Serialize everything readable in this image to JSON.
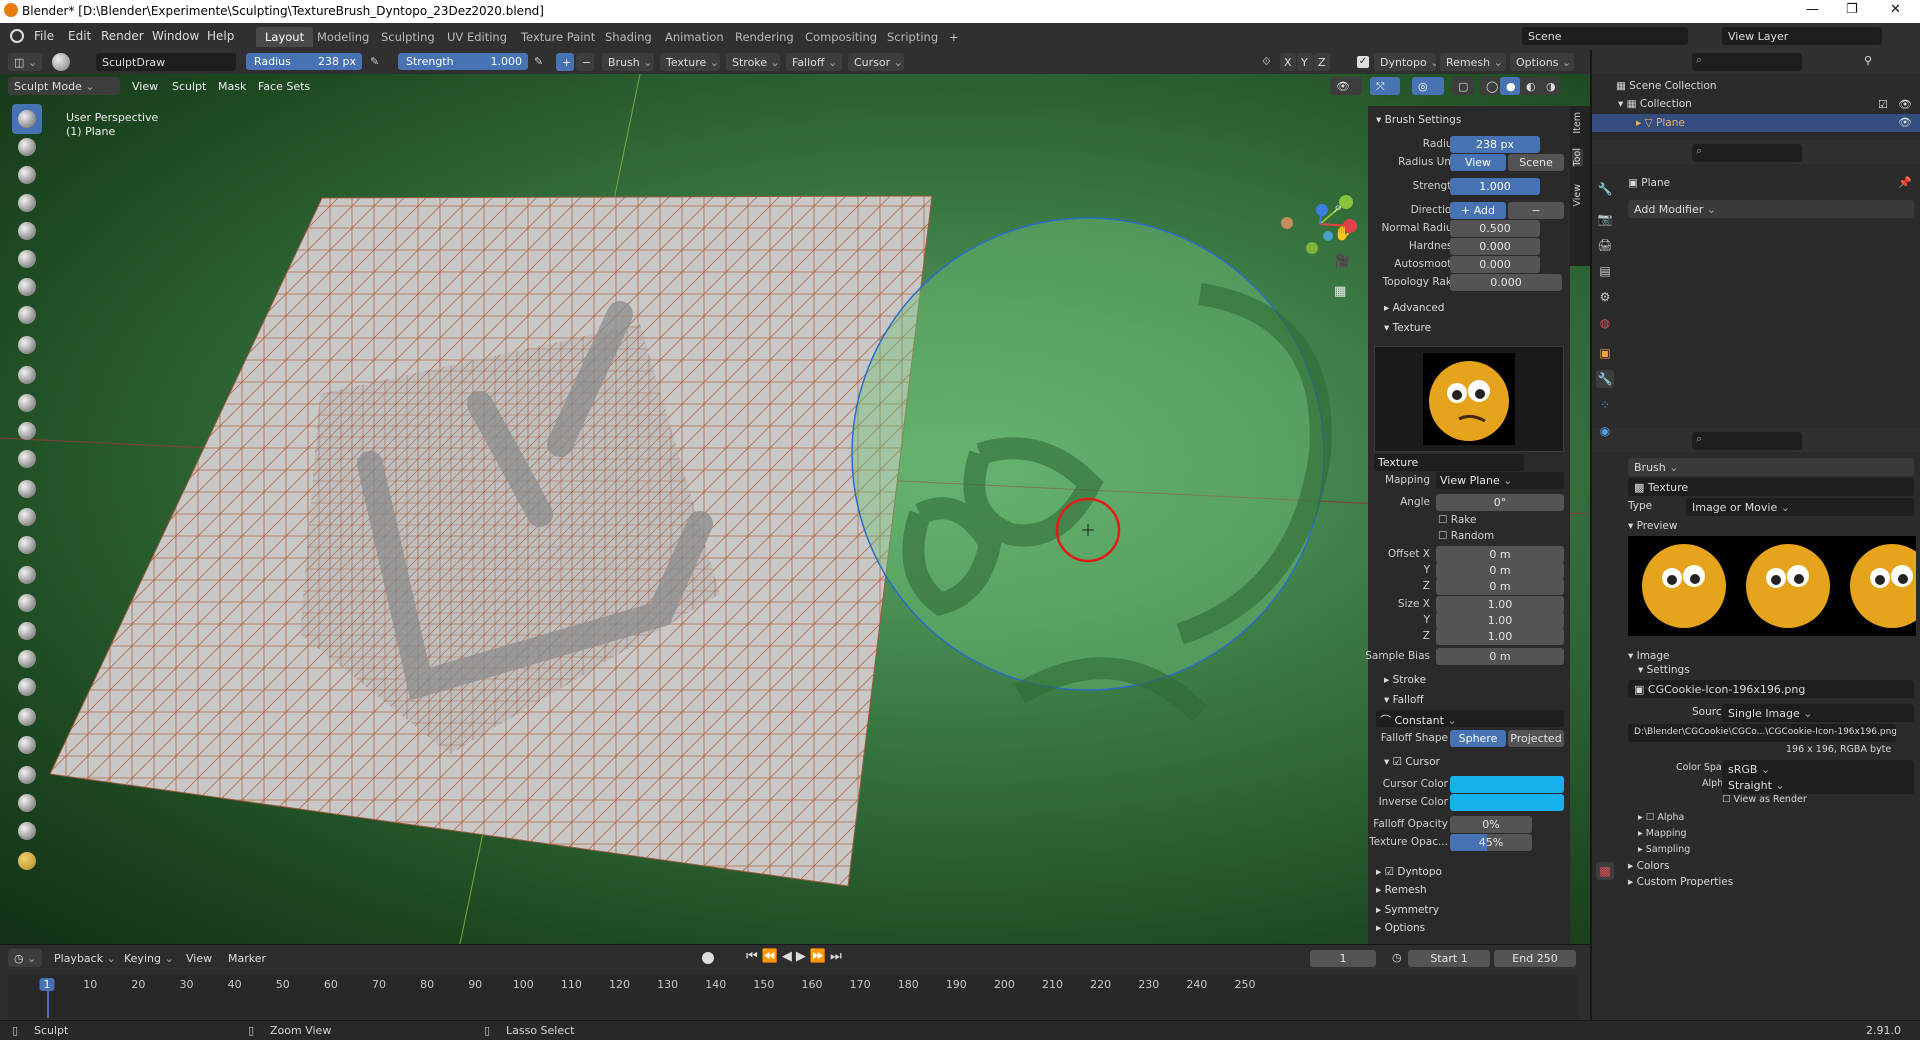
{
  "window": {
    "title": "Blender* [D:\\Blender\\Experimente\\Sculpting\\TextureBrush_Dyntopo_23Dez2020.blend]",
    "min": "—",
    "max": "❐",
    "close": "✕"
  },
  "menu": [
    "File",
    "Edit",
    "Render",
    "Window",
    "Help"
  ],
  "workspaces": [
    "Layout",
    "Modeling",
    "Sculpting",
    "UV Editing",
    "Texture Paint",
    "Shading",
    "Animation",
    "Rendering",
    "Compositing",
    "Scripting",
    "+"
  ],
  "scene": {
    "label": "Scene",
    "viewlayer": "View Layer"
  },
  "toolheader": {
    "brush_name": "SculptDraw",
    "radius_label": "Radius",
    "radius_value": "238 px",
    "strength_label": "Strength",
    "strength_value": "1.000",
    "brush": "Brush",
    "texture": "Texture",
    "stroke": "Stroke",
    "falloff": "Falloff",
    "cursor": "Cursor",
    "x": "X",
    "y": "Y",
    "z": "Z",
    "dyntopo": "Dyntopo",
    "remesh": "Remesh",
    "options": "Options"
  },
  "viewheader": {
    "mode": "Sculpt Mode",
    "menus": [
      "View",
      "Sculpt",
      "Mask",
      "Face Sets"
    ]
  },
  "viewport": {
    "perspective": "User Perspective",
    "object": "(1) Plane"
  },
  "npanel": {
    "tabs": [
      "Item",
      "Tool",
      "View"
    ],
    "brush_settings": "Brush Settings",
    "radius_label": "Radius",
    "radius_value": "238 px",
    "radius_unit_label": "Radius Unit",
    "unit_view": "View",
    "unit_scene": "Scene",
    "strength_label": "Strength",
    "strength_value": "1.000",
    "direction_label": "Direction",
    "dir_add": "+ Add",
    "dir_sub": "− Subtract",
    "normal_radius_label": "Normal Radius",
    "normal_radius": "0.500",
    "hardness_label": "Hardness",
    "hardness": "0.000",
    "autosmooth_label": "Autosmooth",
    "autosmooth": "0.000",
    "topology_label": "Topology Rake",
    "topology": "0.000",
    "advanced": "Advanced",
    "texture_hdr": "Texture",
    "texture_name": "Texture",
    "mapping_label": "Mapping",
    "mapping": "View Plane",
    "angle_label": "Angle",
    "angle": "0°",
    "rake": "Rake",
    "random": "Random",
    "offset_x_label": "Offset X",
    "y_label": "Y",
    "z_label": "Z",
    "offset_x": "0 m",
    "offset_y": "0 m",
    "offset_z": "0 m",
    "size_x_label": "Size X",
    "size_x": "1.00",
    "size_y": "1.00",
    "size_z": "1.00",
    "sample_bias_label": "Sample Bias",
    "sample_bias": "0 m",
    "stroke": "Stroke",
    "falloff": "Falloff",
    "falloff_preset": "Constant",
    "falloff_shape_label": "Falloff Shape",
    "sphere": "Sphere",
    "projected": "Projected",
    "cursor": "Cursor",
    "cursor_color_label": "Cursor Color",
    "inverse_color_label": "Inverse Color",
    "cursor_color": "#16b0ef",
    "inverse_color": "#16b0ef",
    "falloff_opacity_label": "Falloff Opacity",
    "falloff_opacity": "0%",
    "texture_opacity_label": "Texture Opac...",
    "texture_opacity": "45%",
    "dyntopo": "Dyntopo",
    "remesh": "Remesh",
    "symmetry": "Symmetry",
    "options": "Options"
  },
  "outliner": {
    "scene_collection": "Scene Collection",
    "collection": "Collection",
    "plane": "Plane"
  },
  "properties_top": {
    "object": "Plane",
    "add_modifier": "Add Modifier"
  },
  "properties_bottom": {
    "brush": "Brush",
    "texture": "Texture",
    "type_label": "Type",
    "type": "Image or Movie",
    "preview": "Preview",
    "image": "Image",
    "settings": "Settings",
    "image_name": "CGCookie-Icon-196x196.png",
    "source_label": "Source",
    "source": "Single Image",
    "path": "D:\\Blender\\CGCookie\\CGCo...\\CGCookie-Icon-196x196.png",
    "info": "196 x 196,  RGBA byte",
    "colorspace_label": "Color Space",
    "colorspace": "sRGB",
    "alpha_label": "Alpha",
    "alpha": "Straight",
    "view_as_render": "View as Render",
    "alpha_sub": "Alpha",
    "mapping": "Mapping",
    "sampling": "Sampling",
    "colors": "Colors",
    "custom_properties": "Custom Properties"
  },
  "timeline": {
    "playback": "Playback",
    "keying": "Keying",
    "view": "View",
    "marker": "Marker",
    "current": "1",
    "start_label": "Start",
    "start": "1",
    "end_label": "End",
    "end": "250",
    "ticks": [
      "1",
      "10",
      "20",
      "30",
      "40",
      "50",
      "60",
      "70",
      "80",
      "90",
      "100",
      "110",
      "120",
      "130",
      "140",
      "150",
      "160",
      "170",
      "180",
      "190",
      "200",
      "210",
      "220",
      "230",
      "240",
      "250"
    ]
  },
  "status": {
    "sculpt": "Sculpt",
    "zoom": "Zoom View",
    "lasso": "Lasso Select",
    "version": "2.91.0"
  }
}
